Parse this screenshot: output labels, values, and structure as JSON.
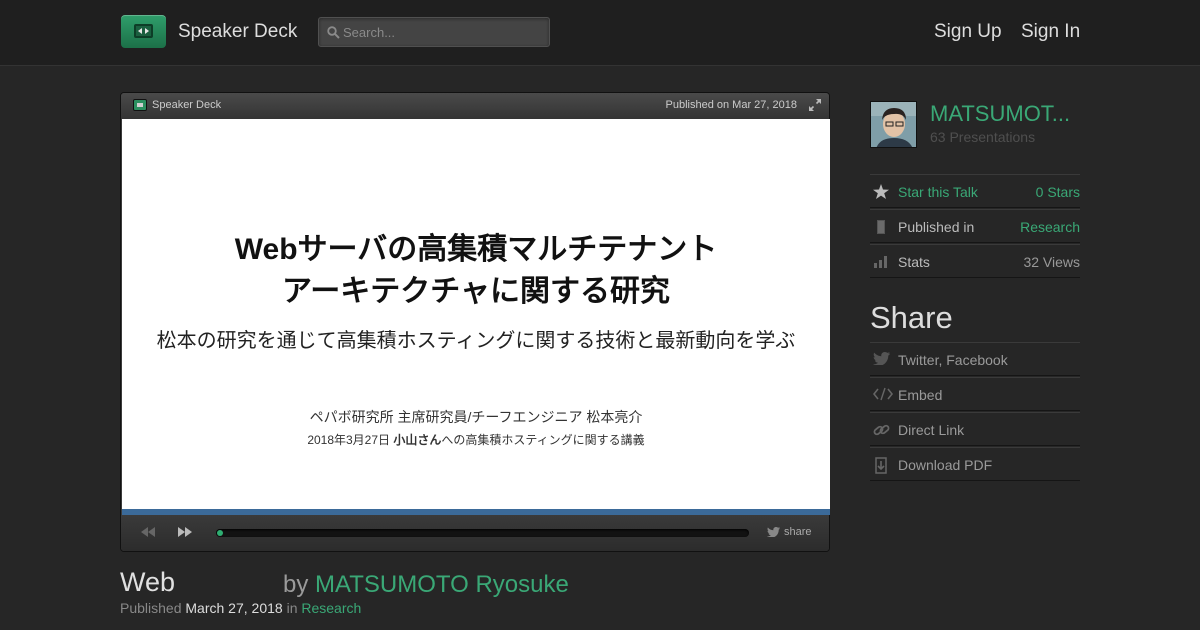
{
  "header": {
    "brand": "Speaker Deck",
    "search_placeholder": "Search...",
    "sign_up": "Sign Up",
    "sign_in": "Sign In"
  },
  "player": {
    "brand": "Speaker Deck",
    "published": "Published on Mar 27, 2018",
    "progress_fraction": 0.01,
    "share_label": "share",
    "slide": {
      "title_line1": "Webサーバの高集積マルチテナント",
      "title_line2": "アーキテクチャに関する研究",
      "subtitle": "松本の研究を通じて高集積ホスティングに関する技術と最新動向を学ぶ",
      "author": "ペパボ研究所 主席研究員/チーフエンジニア 松本亮介",
      "note_prefix": "2018年3月27日 ",
      "note_bold": "小山さん",
      "note_suffix": "への高集積ホスティングに関する講義"
    }
  },
  "talk": {
    "title": "Web",
    "by": "by ",
    "author": "MATSUMOTO Ryosuke",
    "published_label": "Published ",
    "date": "March 27, 2018",
    "in_label": " in ",
    "category": "Research"
  },
  "sidebar": {
    "author_name": "MATSUMOT...",
    "presentations": "63 Presentations",
    "star_label": "Star this Talk",
    "stars": "0 Stars",
    "published_in_label": "Published in",
    "category": "Research",
    "stats_label": "Stats",
    "views": "32 Views",
    "share_heading": "Share",
    "share_items": [
      "Twitter, Facebook",
      "Embed",
      "Direct Link",
      "Download PDF"
    ]
  },
  "colors": {
    "accent": "#3aa876",
    "background": "#262626",
    "slide_bar": "#3b6a99"
  },
  "icons": {
    "logo": "speaker-deck-logo-icon",
    "search": "search-icon",
    "expand": "expand-icon",
    "prev": "rewind-icon",
    "next": "fast-forward-icon",
    "share": "twitter-bird-icon",
    "star": "star-icon",
    "bookmark": "bookmark-icon",
    "stats": "bar-chart-icon",
    "embed": "code-icon",
    "link": "link-icon",
    "download": "download-icon"
  }
}
